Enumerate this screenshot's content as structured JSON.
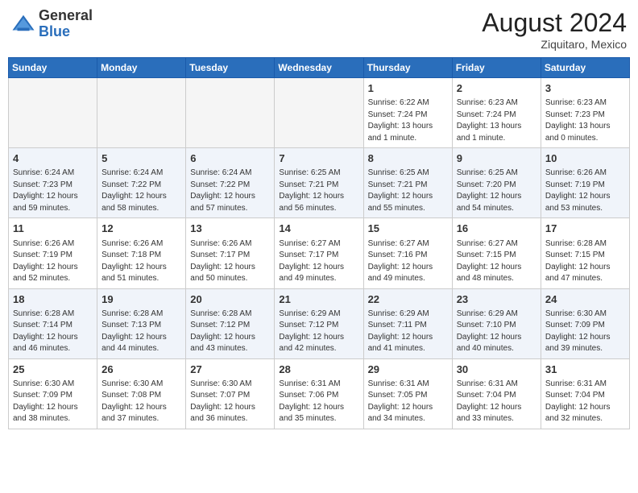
{
  "header": {
    "logo_general": "General",
    "logo_blue": "Blue",
    "month_year": "August 2024",
    "location": "Ziquitaro, Mexico"
  },
  "weekdays": [
    "Sunday",
    "Monday",
    "Tuesday",
    "Wednesday",
    "Thursday",
    "Friday",
    "Saturday"
  ],
  "rows": [
    {
      "class": "row-odd",
      "days": [
        {
          "num": "",
          "info": "",
          "empty": true
        },
        {
          "num": "",
          "info": "",
          "empty": true
        },
        {
          "num": "",
          "info": "",
          "empty": true
        },
        {
          "num": "",
          "info": "",
          "empty": true
        },
        {
          "num": "1",
          "info": "Sunrise: 6:22 AM\nSunset: 7:24 PM\nDaylight: 13 hours\nand 1 minute.",
          "empty": false
        },
        {
          "num": "2",
          "info": "Sunrise: 6:23 AM\nSunset: 7:24 PM\nDaylight: 13 hours\nand 1 minute.",
          "empty": false
        },
        {
          "num": "3",
          "info": "Sunrise: 6:23 AM\nSunset: 7:23 PM\nDaylight: 13 hours\nand 0 minutes.",
          "empty": false
        }
      ]
    },
    {
      "class": "row-even",
      "days": [
        {
          "num": "4",
          "info": "Sunrise: 6:24 AM\nSunset: 7:23 PM\nDaylight: 12 hours\nand 59 minutes.",
          "empty": false
        },
        {
          "num": "5",
          "info": "Sunrise: 6:24 AM\nSunset: 7:22 PM\nDaylight: 12 hours\nand 58 minutes.",
          "empty": false
        },
        {
          "num": "6",
          "info": "Sunrise: 6:24 AM\nSunset: 7:22 PM\nDaylight: 12 hours\nand 57 minutes.",
          "empty": false
        },
        {
          "num": "7",
          "info": "Sunrise: 6:25 AM\nSunset: 7:21 PM\nDaylight: 12 hours\nand 56 minutes.",
          "empty": false
        },
        {
          "num": "8",
          "info": "Sunrise: 6:25 AM\nSunset: 7:21 PM\nDaylight: 12 hours\nand 55 minutes.",
          "empty": false
        },
        {
          "num": "9",
          "info": "Sunrise: 6:25 AM\nSunset: 7:20 PM\nDaylight: 12 hours\nand 54 minutes.",
          "empty": false
        },
        {
          "num": "10",
          "info": "Sunrise: 6:26 AM\nSunset: 7:19 PM\nDaylight: 12 hours\nand 53 minutes.",
          "empty": false
        }
      ]
    },
    {
      "class": "row-odd",
      "days": [
        {
          "num": "11",
          "info": "Sunrise: 6:26 AM\nSunset: 7:19 PM\nDaylight: 12 hours\nand 52 minutes.",
          "empty": false
        },
        {
          "num": "12",
          "info": "Sunrise: 6:26 AM\nSunset: 7:18 PM\nDaylight: 12 hours\nand 51 minutes.",
          "empty": false
        },
        {
          "num": "13",
          "info": "Sunrise: 6:26 AM\nSunset: 7:17 PM\nDaylight: 12 hours\nand 50 minutes.",
          "empty": false
        },
        {
          "num": "14",
          "info": "Sunrise: 6:27 AM\nSunset: 7:17 PM\nDaylight: 12 hours\nand 49 minutes.",
          "empty": false
        },
        {
          "num": "15",
          "info": "Sunrise: 6:27 AM\nSunset: 7:16 PM\nDaylight: 12 hours\nand 49 minutes.",
          "empty": false
        },
        {
          "num": "16",
          "info": "Sunrise: 6:27 AM\nSunset: 7:15 PM\nDaylight: 12 hours\nand 48 minutes.",
          "empty": false
        },
        {
          "num": "17",
          "info": "Sunrise: 6:28 AM\nSunset: 7:15 PM\nDaylight: 12 hours\nand 47 minutes.",
          "empty": false
        }
      ]
    },
    {
      "class": "row-even",
      "days": [
        {
          "num": "18",
          "info": "Sunrise: 6:28 AM\nSunset: 7:14 PM\nDaylight: 12 hours\nand 46 minutes.",
          "empty": false
        },
        {
          "num": "19",
          "info": "Sunrise: 6:28 AM\nSunset: 7:13 PM\nDaylight: 12 hours\nand 44 minutes.",
          "empty": false
        },
        {
          "num": "20",
          "info": "Sunrise: 6:28 AM\nSunset: 7:12 PM\nDaylight: 12 hours\nand 43 minutes.",
          "empty": false
        },
        {
          "num": "21",
          "info": "Sunrise: 6:29 AM\nSunset: 7:12 PM\nDaylight: 12 hours\nand 42 minutes.",
          "empty": false
        },
        {
          "num": "22",
          "info": "Sunrise: 6:29 AM\nSunset: 7:11 PM\nDaylight: 12 hours\nand 41 minutes.",
          "empty": false
        },
        {
          "num": "23",
          "info": "Sunrise: 6:29 AM\nSunset: 7:10 PM\nDaylight: 12 hours\nand 40 minutes.",
          "empty": false
        },
        {
          "num": "24",
          "info": "Sunrise: 6:30 AM\nSunset: 7:09 PM\nDaylight: 12 hours\nand 39 minutes.",
          "empty": false
        }
      ]
    },
    {
      "class": "row-odd",
      "days": [
        {
          "num": "25",
          "info": "Sunrise: 6:30 AM\nSunset: 7:09 PM\nDaylight: 12 hours\nand 38 minutes.",
          "empty": false
        },
        {
          "num": "26",
          "info": "Sunrise: 6:30 AM\nSunset: 7:08 PM\nDaylight: 12 hours\nand 37 minutes.",
          "empty": false
        },
        {
          "num": "27",
          "info": "Sunrise: 6:30 AM\nSunset: 7:07 PM\nDaylight: 12 hours\nand 36 minutes.",
          "empty": false
        },
        {
          "num": "28",
          "info": "Sunrise: 6:31 AM\nSunset: 7:06 PM\nDaylight: 12 hours\nand 35 minutes.",
          "empty": false
        },
        {
          "num": "29",
          "info": "Sunrise: 6:31 AM\nSunset: 7:05 PM\nDaylight: 12 hours\nand 34 minutes.",
          "empty": false
        },
        {
          "num": "30",
          "info": "Sunrise: 6:31 AM\nSunset: 7:04 PM\nDaylight: 12 hours\nand 33 minutes.",
          "empty": false
        },
        {
          "num": "31",
          "info": "Sunrise: 6:31 AM\nSunset: 7:04 PM\nDaylight: 12 hours\nand 32 minutes.",
          "empty": false
        }
      ]
    }
  ]
}
